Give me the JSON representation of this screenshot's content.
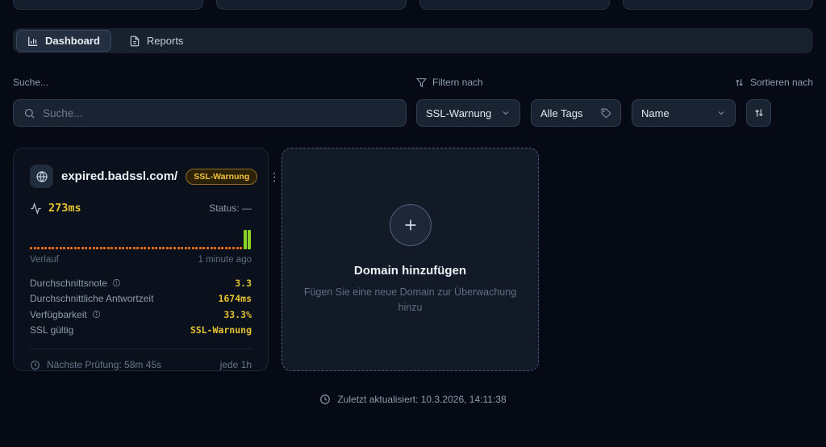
{
  "colors": {
    "accent_yellow": "#e5c22f",
    "orange": "#f97316",
    "green": "#8cd226",
    "badge_text": "#f2c341",
    "badge_bg": "#2d2106",
    "badge_border": "#8d6e22"
  },
  "icons": [
    "bar-chart-icon",
    "document-icon",
    "search-icon",
    "funnel-icon",
    "sort-arrows-icon",
    "chevron-down-icon",
    "tag-icon",
    "globe-icon",
    "activity-icon",
    "kebab-menu-icon",
    "info-icon",
    "clock-icon",
    "plus-icon"
  ],
  "tabs": [
    {
      "label": "Dashboard",
      "icon": "bar-chart",
      "active": true
    },
    {
      "label": "Reports",
      "icon": "document",
      "active": false
    }
  ],
  "search": {
    "label": "Suche...",
    "placeholder": "Suche..."
  },
  "filter": {
    "label": "Filtern nach",
    "status_dropdown_value": "SSL-Warnung",
    "tags_button_label": "Alle Tags",
    "sort_label": "Sortieren nach",
    "sort_dropdown_value": "Name"
  },
  "domain_card": {
    "title": "expired.badssl.com/",
    "badge": "SSL-Warnung",
    "response_time": "273ms",
    "status_label": "Status:",
    "status_value": "—",
    "history": {
      "warning_dots": 58,
      "ok_bars": 2
    },
    "history_label": "Verlauf",
    "history_ago": "1 minute ago",
    "stats": [
      {
        "label": "Durchschnittsnote",
        "value": "3.3"
      },
      {
        "label": "Durchschnittliche Antwortzeit",
        "value": "1674ms"
      },
      {
        "label": "Verfügbarkeit",
        "value": "33.3%"
      },
      {
        "label": "SSL gültig",
        "value": "SSL-Warnung"
      }
    ],
    "next_check": "Nächste Prüfung: 58m 45s",
    "interval": "jede 1h"
  },
  "add_card": {
    "title": "Domain hinzufügen",
    "subtitle": "Fügen Sie eine neue Domain zur Überwachung hinzu"
  },
  "footer": {
    "last_updated": "Zuletzt aktualisiert: 10.3.2026, 14:11:38"
  }
}
